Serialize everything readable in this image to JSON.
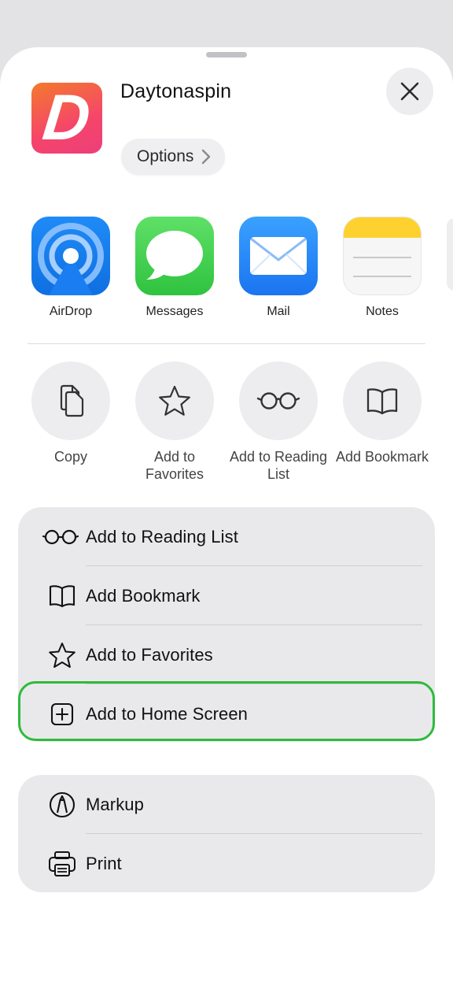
{
  "header": {
    "app_title": "Daytonaspin",
    "app_icon_letter": "D",
    "options_label": "Options"
  },
  "share_apps": [
    {
      "label": "AirDrop"
    },
    {
      "label": "Messages"
    },
    {
      "label": "Mail"
    },
    {
      "label": "Notes"
    }
  ],
  "quick_actions": [
    {
      "label": "Copy"
    },
    {
      "label": "Add to Favorites"
    },
    {
      "label": "Add to Reading List"
    },
    {
      "label": "Add Bookmark"
    }
  ],
  "menu_group_1": [
    {
      "label": "Add to Reading List",
      "icon": "glasses-icon"
    },
    {
      "label": "Add Bookmark",
      "icon": "book-icon"
    },
    {
      "label": "Add to Favorites",
      "icon": "star-icon"
    },
    {
      "label": "Add to Home Screen",
      "icon": "plus-square-icon"
    }
  ],
  "menu_group_2": [
    {
      "label": "Markup",
      "icon": "markup-icon"
    },
    {
      "label": "Print",
      "icon": "printer-icon"
    }
  ],
  "colors": {
    "highlight": "#2dbb3c",
    "sheet": "#ffffff",
    "group_bg": "#e9e9eb"
  }
}
